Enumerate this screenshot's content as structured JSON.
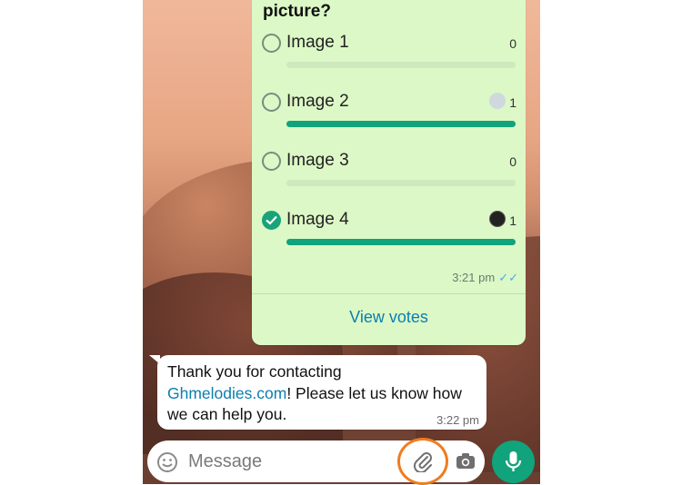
{
  "poll": {
    "question": "picture?",
    "options": [
      {
        "label": "Image 1",
        "count": "0",
        "fill": 0,
        "selected": false
      },
      {
        "label": "Image 2",
        "count": "1",
        "fill": 1,
        "selected": false
      },
      {
        "label": "Image 3",
        "count": "0",
        "fill": 0,
        "selected": false
      },
      {
        "label": "Image 4",
        "count": "1",
        "fill": 1,
        "selected": true
      }
    ],
    "time": "3:21 pm",
    "view_votes": "View votes"
  },
  "message": {
    "text_before": "Thank you for contacting ",
    "link": "Ghmelodies.com",
    "text_after": "! Please let us know how we can help you.",
    "time": "3:22 pm"
  },
  "composer": {
    "placeholder": "Message"
  },
  "icons": {
    "emoji": "smiley-icon",
    "attach": "paperclip-icon",
    "camera": "camera-icon",
    "mic": "microphone-icon"
  },
  "colors": {
    "poll_bubble": "#dcf8c6",
    "accent_green": "#11a37b",
    "link_blue": "#0b7fae",
    "highlight_ring": "#f07c1f"
  }
}
